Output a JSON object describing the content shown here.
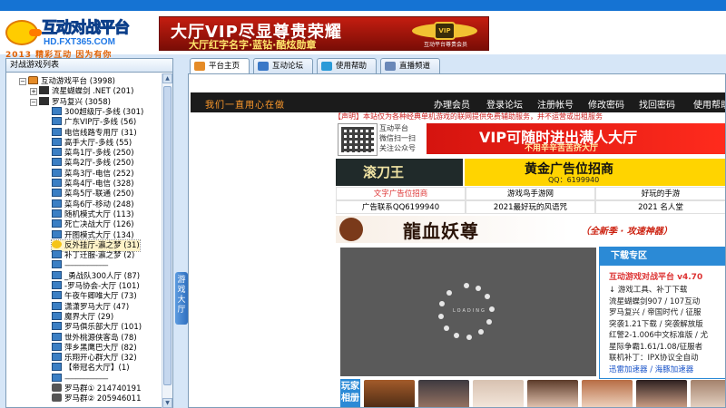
{
  "header": {
    "logo_title": "互动对战平台",
    "logo_url": "HD.FXT365.COM",
    "logo_slogan": "2013 精彩互动 因为有你",
    "vip_banner_line1": "大厅VIP尽显尊贵荣耀",
    "vip_banner_line2": "大厅红字名字·蓝钻·酷炫勋章",
    "vip_badge_caption": "互动平台尊贵会员"
  },
  "left_panel": {
    "title": "对战游戏列表",
    "tree": [
      {
        "label": "互动游戏平台 (3998)",
        "depth": 0,
        "icon": "home-icon",
        "expanded": true
      },
      {
        "label": "流星蝴蝶剑 .NET (201)",
        "depth": 1,
        "icon": "flag-icon",
        "expanded": false
      },
      {
        "label": "罗马复兴 (3058)",
        "depth": 1,
        "icon": "flag-icon",
        "expanded": true
      },
      {
        "label": "300超级厅-多线 (301)",
        "depth": 2,
        "icon": "pc-icon"
      },
      {
        "label": "广东VIP厅-多线 (56)",
        "depth": 2,
        "icon": "pc-icon"
      },
      {
        "label": "电信线路专用厅 (31)",
        "depth": 2,
        "icon": "pc-icon"
      },
      {
        "label": "高手大厅-多线 (55)",
        "depth": 2,
        "icon": "pc-icon"
      },
      {
        "label": "菜鸟1厅-多线 (250)",
        "depth": 2,
        "icon": "pc-icon"
      },
      {
        "label": "菜鸟2厅-多线 (250)",
        "depth": 2,
        "icon": "pc-icon"
      },
      {
        "label": "菜鸟3厅-电信 (252)",
        "depth": 2,
        "icon": "pc-icon"
      },
      {
        "label": "菜鸟4厅-电信 (328)",
        "depth": 2,
        "icon": "pc-icon"
      },
      {
        "label": "菜鸟5厅-联通 (250)",
        "depth": 2,
        "icon": "pc-icon"
      },
      {
        "label": "菜鸟6厅-移动 (248)",
        "depth": 2,
        "icon": "pc-icon"
      },
      {
        "label": "随机模式大厅 (113)",
        "depth": 2,
        "icon": "pc-icon"
      },
      {
        "label": "死亡决战大厅 (126)",
        "depth": 2,
        "icon": "pc-icon"
      },
      {
        "label": "开图模式大厅 (134)",
        "depth": 2,
        "icon": "pc-icon"
      },
      {
        "label": "反外挂厅-瀛之梦 (31)",
        "depth": 2,
        "icon": "star-icon",
        "selected": true
      },
      {
        "label": "补丁迁服-瀛之梦 (2)",
        "depth": 2,
        "icon": "pc-icon"
      },
      {
        "label": "-----------------------",
        "depth": 2,
        "icon": "pc-icon",
        "dash": true
      },
      {
        "label": "_勇战队300人厅 (87)",
        "depth": 2,
        "icon": "pc-icon"
      },
      {
        "label": "-罗马协会-大厅 (101)",
        "depth": 2,
        "icon": "pc-icon"
      },
      {
        "label": "午夜午卿唯大厅 (73)",
        "depth": 2,
        "icon": "pc-icon"
      },
      {
        "label": "潇潇罗马大厅 (47)",
        "depth": 2,
        "icon": "pc-icon"
      },
      {
        "label": "魔界大厅 (29)",
        "depth": 2,
        "icon": "pc-icon"
      },
      {
        "label": "罗马俱乐部大厅 (101)",
        "depth": 2,
        "icon": "pc-icon"
      },
      {
        "label": "世外桃源侠客岛 (78)",
        "depth": 2,
        "icon": "pc-icon"
      },
      {
        "label": "萍乡黑鹰巴大厅 (82)",
        "depth": 2,
        "icon": "pc-icon"
      },
      {
        "label": "乐翔开心群大厅 (32)",
        "depth": 2,
        "icon": "pc-icon"
      },
      {
        "label": "【帝冠名大厅】(1)",
        "depth": 2,
        "icon": "pc-icon"
      },
      {
        "label": "-----------------------",
        "depth": 2,
        "icon": "pc-icon",
        "dash": true
      },
      {
        "label": "罗马群① 214740191",
        "depth": 2,
        "icon": "group-icon"
      },
      {
        "label": "罗马群② 205946011",
        "depth": 2,
        "icon": "group-icon"
      }
    ],
    "side_toggle": "游戏大厅"
  },
  "tabs": [
    {
      "label": "平台主页",
      "icon": "home-icon",
      "active": true,
      "color": "#e58b27"
    },
    {
      "label": "互动论坛",
      "icon": "forum-icon",
      "active": false,
      "color": "#3a78c7"
    },
    {
      "label": "使用帮助",
      "icon": "help-icon",
      "active": false,
      "color": "#2a9ad8"
    },
    {
      "label": "直播频道",
      "icon": "tv-icon",
      "active": false,
      "color": "#6a88b8"
    }
  ],
  "webpage": {
    "nav_slogan": "我们一直用心在做",
    "nav_links": [
      "办理会员",
      "登录论坛",
      "注册帐号",
      "修改密码",
      "找回密码",
      "使用帮助"
    ],
    "notice": "【声明】本站仅为各种经典单机游戏的联网提供免费辅助服务，并不运营或出租服务",
    "qr_text": [
      "互动平台",
      "微信扫一扫",
      "关注公众号"
    ],
    "vip_ad_title": "VIP可随时进出满人大厅",
    "vip_ad_sub": "不用辛辛苦苦挤大厅",
    "game_logo": "滚刀王",
    "gold_ad_title": "黄金广告位招商",
    "gold_ad_qq": "QQ：6199940",
    "links": [
      [
        "文字广告位招商",
        "游戏鸟手游网",
        "好玩的手游"
      ],
      [
        "广告联系QQ6199940",
        "2021最好玩的风语咒",
        "2021 名人堂"
      ]
    ],
    "dragon_title": "龍血妖尊",
    "dragon_sub": "（全新季 · 攻速神器）",
    "loading_text": "LOADING",
    "download": {
      "head": "下载专区",
      "title": "互动游戏对战平台 v4.70",
      "items": [
        "↓ 游戏工具、补丁下载",
        "流星蝴蝶剑907 / 107互动",
        "罗马复兴 / 帝国时代 / 征服",
        "突袭1.21下载 / 突袭解放版",
        "红警2-1.006中文标准版 / 尤",
        "星际争霸1.61/1.08/征服者",
        "联机补丁：IPX协议全自动",
        "迅雷加速器 / 海豚加速器"
      ]
    },
    "players_label": "玩家相册"
  },
  "colors": {
    "brand_blue": "#1573d3",
    "vip_red": "#c41d10",
    "gold": "#ffd400",
    "download_blue": "#2b8ad6"
  }
}
